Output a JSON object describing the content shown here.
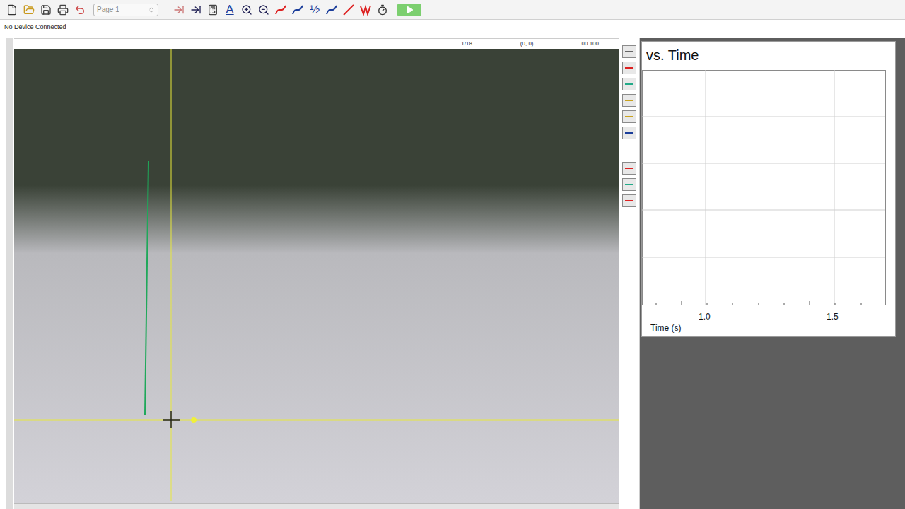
{
  "toolbar": {
    "page_select": "Page 1",
    "fraction_glyph": "½",
    "type_glyph": "A"
  },
  "status": "No Device Connected",
  "video": {
    "frame": "1/18",
    "origin": "(0, 0)",
    "time": "00.100"
  },
  "graph": {
    "title": "vs. Time",
    "x_ticks": [
      "1.0",
      "1.5"
    ],
    "x_label": "Time (s)"
  }
}
